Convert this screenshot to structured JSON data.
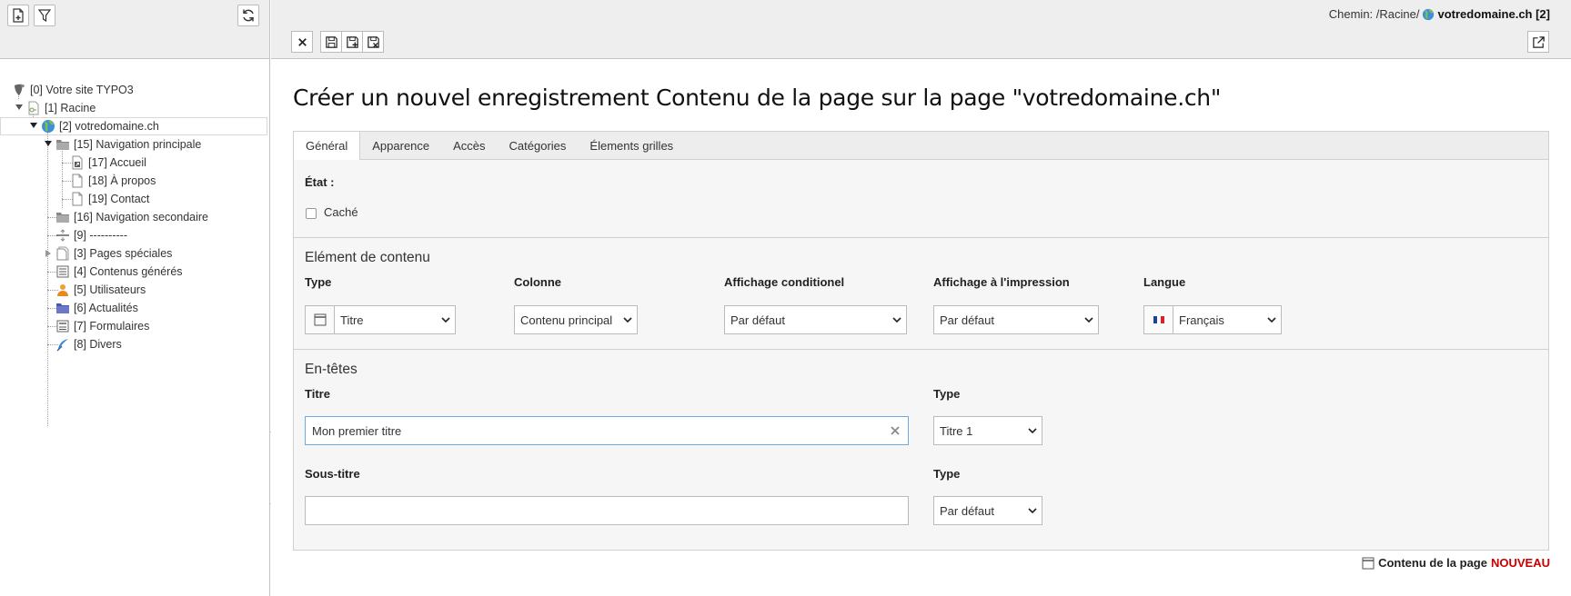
{
  "tree": {
    "nodes": [
      {
        "label": "[0] Votre site TYPO3",
        "icon": "typo3-logo-icon"
      },
      {
        "label": "[1] Racine",
        "icon": "page-root-icon"
      },
      {
        "label": "[2] votredomaine.ch",
        "icon": "globe-icon"
      },
      {
        "label": "[15] Navigation principale",
        "icon": "folder-icon"
      },
      {
        "label": "[17] Accueil",
        "icon": "page-shortcut-icon"
      },
      {
        "label": "[18] À propos",
        "icon": "page-icon"
      },
      {
        "label": "[19] Contact",
        "icon": "page-icon"
      },
      {
        "label": "[16] Navigation secondaire",
        "icon": "folder-icon"
      },
      {
        "label": "[9] ----------",
        "icon": "spacer-icon"
      },
      {
        "label": "[3] Pages spéciales",
        "icon": "page-special-icon"
      },
      {
        "label": "[4] Contenus générés",
        "icon": "list-icon"
      },
      {
        "label": "[5] Utilisateurs",
        "icon": "users-icon"
      },
      {
        "label": "[6] Actualités",
        "icon": "folder-news-icon"
      },
      {
        "label": "[7] Formulaires",
        "icon": "form-icon"
      },
      {
        "label": "[8] Divers",
        "icon": "feather-icon"
      }
    ]
  },
  "header": {
    "path_prefix": "Chemin: /Racine/",
    "path_current": "votredomaine.ch [2]"
  },
  "title": "Créer un nouvel enregistrement Contenu de la page sur la page \"votredomaine.ch\"",
  "tabs": [
    "Général",
    "Apparence",
    "Accès",
    "Catégories",
    "Élements grilles"
  ],
  "etat": {
    "label": "État :",
    "hidden_label": "Caché",
    "hidden_checked": false
  },
  "element": {
    "section_title": "Elément de contenu",
    "type_label": "Type",
    "type_value": "Titre",
    "colonne_label": "Colonne",
    "colonne_value": "Contenu principal",
    "affichage_label": "Affichage conditionel",
    "affichage_value": "Par défaut",
    "impression_label": "Affichage à l'impression",
    "impression_value": "Par défaut",
    "langue_label": "Langue",
    "langue_value": "Français"
  },
  "entetes": {
    "section_title": "En-têtes",
    "titre_label": "Titre",
    "titre_value": "Mon premier titre",
    "type1_label": "Type",
    "type1_value": "Titre 1",
    "soustitre_label": "Sous-titre",
    "soustitre_value": "",
    "type2_label": "Type",
    "type2_value": "Par défaut"
  },
  "footer": {
    "label": "Contenu de la page",
    "status": "NOUVEAU",
    "status_color": "#cc0000"
  }
}
